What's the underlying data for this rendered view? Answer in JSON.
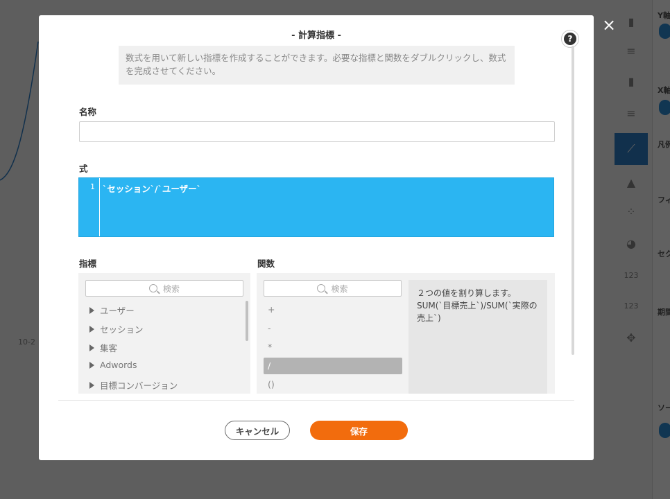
{
  "background": {
    "axis_label": "10-2",
    "right_panel_labels": [
      "Y軸",
      "X軸",
      "凡例",
      "フィ",
      "セク",
      "期間",
      "ソー"
    ],
    "icons": [
      "bar-chart-icon",
      "horizontal-bar-icon",
      "stacked-bar-icon",
      "stacked-horizontal-icon",
      "line-chart-icon",
      "area-chart-icon",
      "scatter-icon",
      "pie-chart-icon",
      "number-icon",
      "number-icon-2",
      "map-icon"
    ],
    "icon_glyphs": [
      "▮",
      "≡",
      "▮",
      "≡",
      "⟋",
      "▲",
      "⁘",
      "◕",
      "123",
      "123",
      "✥"
    ],
    "active_icon_index": 4,
    "accent_color": "#2f7fc8"
  },
  "modal": {
    "title": "- 計算指標 -",
    "help_glyph": "?",
    "close_glyph": "×",
    "description": "数式を用いて新しい指標を作成することができます。必要な指標と関数をダブルクリックし、数式を完成させてください。",
    "name_label": "名称",
    "name_value": "",
    "formula_label": "式",
    "formula_line_number": "1",
    "formula_text": "`セッション`/`ユーザー`",
    "editor_color": "#2bb5f2",
    "metrics": {
      "label": "指標",
      "search_placeholder": "検索",
      "items": [
        "ユーザー",
        "セッション",
        "集客",
        "Adwords",
        "目標コンバージョン"
      ]
    },
    "functions": {
      "label": "関数",
      "search_placeholder": "検索",
      "items": [
        "+",
        "-",
        "*",
        "/",
        "()"
      ],
      "selected_index": 3,
      "description": "２つの値を割り算します。SUM(`目標売上`)/SUM(`実際の売上`)"
    },
    "cancel_label": "キャンセル",
    "save_label": "保存",
    "save_color": "#f26c0d"
  }
}
